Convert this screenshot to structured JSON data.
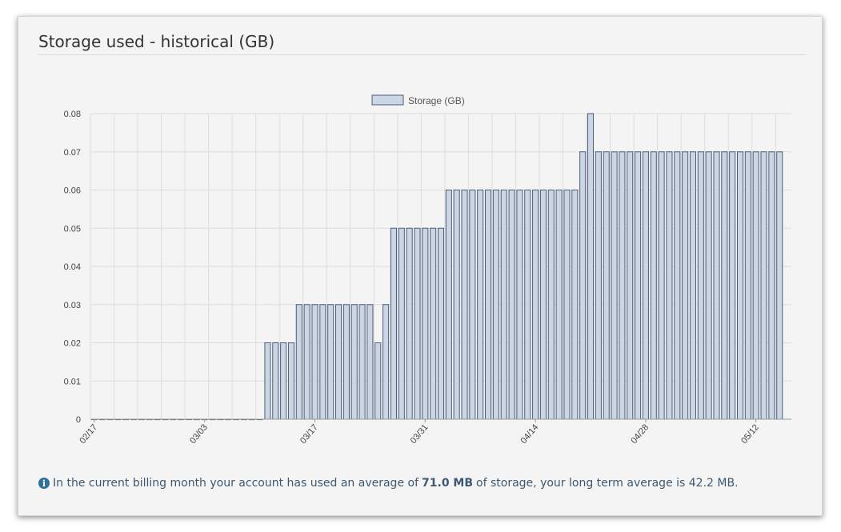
{
  "panel": {
    "title": "Storage used - historical (GB)"
  },
  "footer": {
    "icon": "info-icon",
    "text_before": "In the current billing month your account has used an average of",
    "highlight": "71.0 MB",
    "text_after": "of storage, your long term average is 42.2 MB."
  },
  "colors": {
    "bar_fill": "#cbd5e3",
    "bar_stroke": "#4d5d78",
    "grid": "#dddddd",
    "axis": "#999999"
  },
  "chart_data": {
    "type": "bar",
    "legend": {
      "label": "Storage (GB)",
      "position": "top-center"
    },
    "ylim": [
      0,
      0.08
    ],
    "yticks": [
      0,
      0.01,
      0.02,
      0.03,
      0.04,
      0.05,
      0.06,
      0.07,
      0.08
    ],
    "ytick_labels": [
      "0",
      "0.01",
      "0.02",
      "0.03",
      "0.04",
      "0.05",
      "0.06",
      "0.07",
      "0.08"
    ],
    "x_start": "02/17",
    "xtick_labels": [
      "02/17",
      "03/03",
      "03/17",
      "03/31",
      "04/14",
      "04/28",
      "05/12"
    ],
    "xtick_every": 14,
    "grid": true,
    "series": [
      {
        "name": "Storage (GB)",
        "values": [
          0,
          0,
          0,
          0,
          0,
          0,
          0,
          0,
          0,
          0,
          0,
          0,
          0,
          0,
          0,
          0,
          0,
          0,
          0,
          0,
          0,
          0,
          0.02,
          0.02,
          0.02,
          0.02,
          0.03,
          0.03,
          0.03,
          0.03,
          0.03,
          0.03,
          0.03,
          0.03,
          0.03,
          0.03,
          0.02,
          0.03,
          0.05,
          0.05,
          0.05,
          0.05,
          0.05,
          0.05,
          0.05,
          0.06,
          0.06,
          0.06,
          0.06,
          0.06,
          0.06,
          0.06,
          0.06,
          0.06,
          0.06,
          0.06,
          0.06,
          0.06,
          0.06,
          0.06,
          0.06,
          0.06,
          0.07,
          0.08,
          0.07,
          0.07,
          0.07,
          0.07,
          0.07,
          0.07,
          0.07,
          0.07,
          0.07,
          0.07,
          0.07,
          0.07,
          0.07,
          0.07,
          0.07,
          0.07,
          0.07,
          0.07,
          0.07,
          0.07,
          0.07,
          0.07,
          0.07,
          0.07
        ]
      }
    ]
  }
}
